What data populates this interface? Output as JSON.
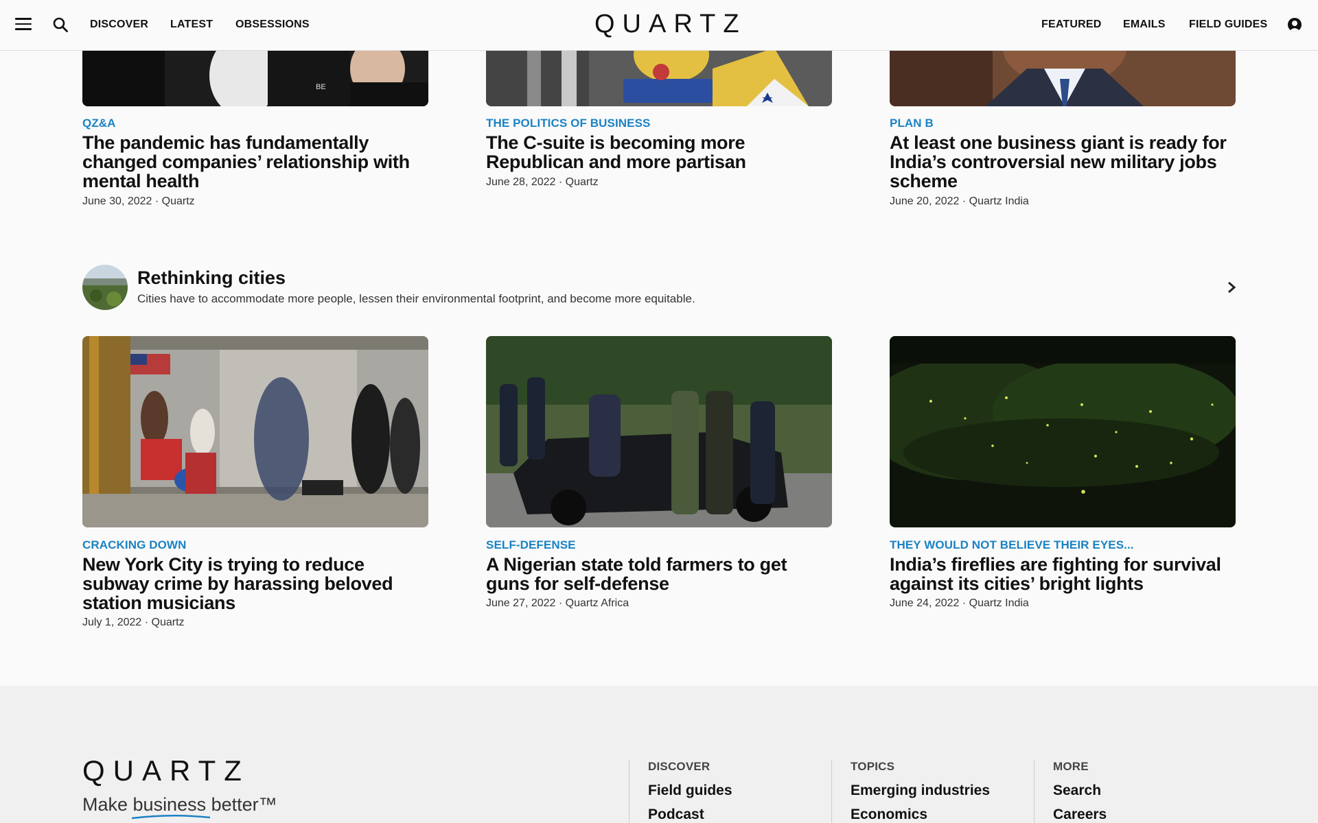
{
  "header": {
    "logo": "QUARTZ",
    "nav_left": [
      "DISCOVER",
      "LATEST",
      "OBSESSIONS"
    ],
    "nav_right": [
      "FEATURED",
      "EMAILS",
      "FIELD GUIDES"
    ]
  },
  "top_cards": [
    {
      "kicker": "QZ&A",
      "headline": "The pandemic has fundamentally changed companies’ relationship with mental health",
      "date": "June 30, 2022",
      "source": "Quartz"
    },
    {
      "kicker": "THE POLITICS OF BUSINESS",
      "headline": "The C-suite is becoming more Republican and more partisan",
      "date": "June 28, 2022",
      "source": "Quartz"
    },
    {
      "kicker": "PLAN B",
      "headline": "At least one business giant is ready for India’s controversial new military jobs scheme",
      "date": "June 20, 2022",
      "source": "Quartz India"
    }
  ],
  "obsession": {
    "title": "Rethinking cities",
    "description": "Cities have to accommodate more people, lessen their environmental footprint, and become more equitable."
  },
  "bottom_cards": [
    {
      "kicker": "CRACKING DOWN",
      "headline": "New York City is trying to reduce subway crime by harassing beloved station musicians",
      "date": "July 1, 2022",
      "source": "Quartz"
    },
    {
      "kicker": "SELF-DEFENSE",
      "headline": "A Nigerian state told farmers to get guns for self-defense",
      "date": "June 27, 2022",
      "source": "Quartz Africa"
    },
    {
      "kicker": "THEY WOULD NOT BELIEVE THEIR EYES...",
      "headline": "India’s fireflies are fighting for survival against its cities’ bright lights",
      "date": "June 24, 2022",
      "source": "Quartz India"
    }
  ],
  "meta_separator": "·",
  "footer": {
    "logo": "QUARTZ",
    "tagline_before": "Make ",
    "tagline_underlined": "business",
    "tagline_after": " better™",
    "columns": [
      {
        "title": "DISCOVER",
        "links": [
          "Field guides",
          "Podcast"
        ]
      },
      {
        "title": "TOPICS",
        "links": [
          "Emerging industries",
          "Economics"
        ]
      },
      {
        "title": "MORE",
        "links": [
          "Search",
          "Careers"
        ]
      }
    ]
  },
  "colors": {
    "accent": "#1a82c4",
    "text": "#111111",
    "background": "#fafafa",
    "footer": "#f0f0f0"
  },
  "icons": [
    "menu-icon",
    "search-icon",
    "user-icon",
    "chevron-right-icon"
  ]
}
